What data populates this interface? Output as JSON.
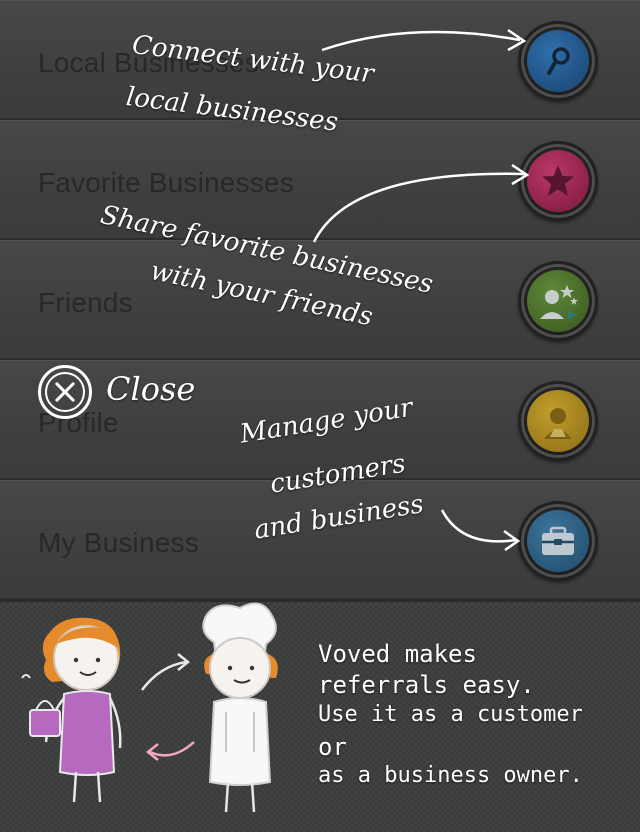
{
  "menu": {
    "items": [
      {
        "label": "Local Businesses",
        "icon": "map-pin-icon",
        "color": "#1d5fa0"
      },
      {
        "label": "Favorite Businesses",
        "icon": "star-icon",
        "color": "#b51f55"
      },
      {
        "label": "Friends",
        "icon": "friends-icon",
        "color": "#4f7d2a"
      },
      {
        "label": "Profile",
        "icon": "profile-icon",
        "color": "#c9a020"
      },
      {
        "label": "My Business",
        "icon": "toolbox-icon",
        "color": "#2d6b95"
      }
    ]
  },
  "help": {
    "connect": [
      "Connect with your",
      "local businesses"
    ],
    "share": [
      "Share favorite businesses",
      "with your friends"
    ],
    "manage": [
      "Manage your",
      "customers",
      "and business"
    ],
    "close_label": "Close"
  },
  "bottom": {
    "tagline": [
      "Voved makes",
      "referrals easy.",
      "Use it as a customer",
      "or",
      "as a business owner."
    ]
  }
}
